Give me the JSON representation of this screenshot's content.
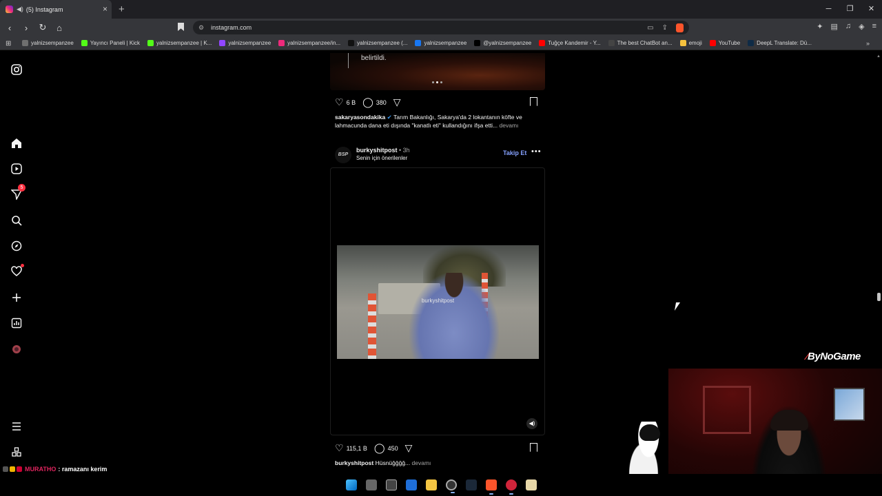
{
  "browser": {
    "tab_title": "(5) Instagram",
    "new_tab_glyph": "+",
    "url": "instagram.com",
    "window_controls": [
      "─",
      "❐",
      "✕"
    ],
    "bookmarks": [
      {
        "label": "yalnizsempanzee",
        "icon": "web-icon",
        "color": "#6f6f6f"
      },
      {
        "label": "Yayıncı Paneli | Kick",
        "icon": "kick-icon",
        "color": "#53fc18"
      },
      {
        "label": "yalnizsempanzee | K...",
        "icon": "kick-icon",
        "color": "#53fc18"
      },
      {
        "label": "yalnizsempanzee",
        "icon": "twitch-icon",
        "color": "#9146ff"
      },
      {
        "label": "yalnizsempanzee/in...",
        "icon": "instagram-icon",
        "color": "#ee2a7b"
      },
      {
        "label": "yalnizsempanzee (...",
        "icon": "tiktok-icon",
        "color": "#111111"
      },
      {
        "label": "yalnizsempanzee",
        "icon": "facebook-icon",
        "color": "#1877f2"
      },
      {
        "label": "@yalnizsempanzee",
        "icon": "x-icon",
        "color": "#000000"
      },
      {
        "label": "Tuğçe Kandemir - Y...",
        "icon": "youtube-icon",
        "color": "#ff0000"
      },
      {
        "label": "The best ChatBot an...",
        "icon": "chatgpt-icon",
        "color": "#444444"
      },
      {
        "label": "emoji",
        "icon": "emoji-icon",
        "color": "#f6c23e"
      },
      {
        "label": "YouTube",
        "icon": "youtube-icon",
        "color": "#ff0000"
      },
      {
        "label": "DeepL Translate: Dü...",
        "icon": "deepl-icon",
        "color": "#0f2b46"
      }
    ]
  },
  "sidebar": {
    "notifications_badge": "5"
  },
  "post1": {
    "caption_overlay": "belirtildi.",
    "likes": "6 B",
    "comments": "380",
    "username": "sakaryasondakika",
    "caption": "Tarım Bakanlığı, Sakarya'da 2 lokantanın köfte ve lahmacunda dana eti dışında \"kanatlı eti\" kullandığını ifşa etti...",
    "more": "devamı"
  },
  "post2": {
    "avatar_text": "BSP",
    "username": "burkyshitpost",
    "time": " • 3h",
    "subtitle": "Senin için önerilenler",
    "follow": "Takip Et",
    "watermark": "burkyshitpost",
    "likes": "115,1 B",
    "comments": "450",
    "caption_user": "burkyshitpost",
    "caption": "Hüsnüğğğğ...",
    "more": "devamı"
  },
  "overlay": {
    "logo_prefix": "∕",
    "logo_text": "ByNoGame",
    "chat_user": "MURATHO",
    "chat_message": ": ramazanı kerim"
  },
  "colors": {
    "accent_link": "#85a1ff",
    "badge_red": "#ff3040",
    "background": "#000000"
  }
}
